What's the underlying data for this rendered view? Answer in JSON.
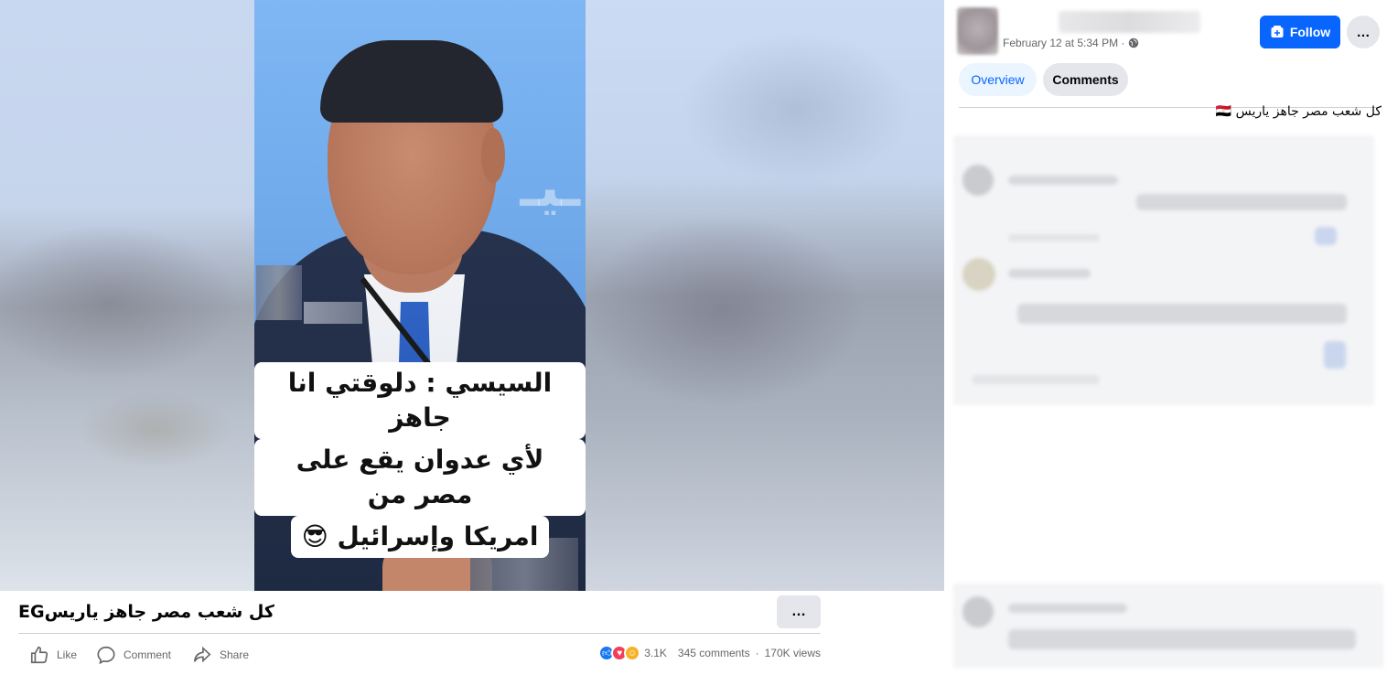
{
  "video": {
    "caption_lines": [
      "السيسي : دلوقتي انا جاهز",
      "لأي عدوان يقع على مصر من",
      "امريكا وإسرائيل 😎"
    ]
  },
  "post": {
    "title": "كل شعب مصر جاهز ياريسEG",
    "more_icon": "…",
    "actions": {
      "like": "Like",
      "comment": "Comment",
      "share": "Share"
    },
    "stats": {
      "reactions": "3.1K",
      "comments": "345 comments",
      "separator": "·",
      "views": "170K views"
    }
  },
  "panel": {
    "timestamp": "February 12 at 5:34 PM ·",
    "follow_label": "Follow",
    "tabs": {
      "overview": "Overview",
      "comments": "Comments"
    },
    "description": "كل شعب مصر جاهز ياريس 🇪🇬"
  },
  "colors": {
    "accent": "#0866ff",
    "like_blue": "#1877f2",
    "love_red": "#f33e58",
    "care_yellow": "#f7b125"
  }
}
